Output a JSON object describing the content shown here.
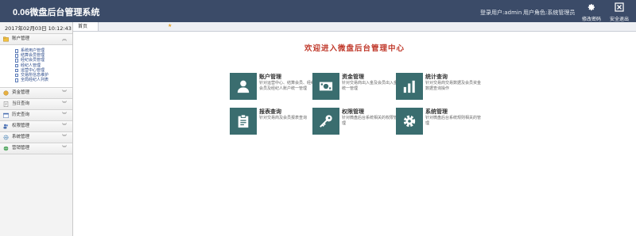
{
  "header": {
    "title": "0.06微盘后台管理系统",
    "login_user": "登录用户:admin",
    "user_role": "用户角色:系统管理员",
    "change_password": "修改密码",
    "logout": "安全退出"
  },
  "sidebar": {
    "datetime": "2017年02月03日 10:12:43",
    "account_menu": {
      "label": "账户管理",
      "items": [
        "系统用户管理",
        "结算会员管理",
        "经纪会员管理",
        "经纪人管理",
        "运营中心管理",
        "交易所信息维护",
        "全局经纪人列表"
      ]
    },
    "menus": [
      {
        "label": "资金管理"
      },
      {
        "label": "当日查询"
      },
      {
        "label": "历史查询"
      },
      {
        "label": "权限管理"
      },
      {
        "label": "系统管理"
      },
      {
        "label": "营销管理"
      }
    ]
  },
  "tabs": [
    {
      "label": "首页"
    }
  ],
  "main": {
    "welcome": "欢迎进入微盘后台管理中心",
    "cards": [
      {
        "title": "账户管理",
        "desc": "针对运营中心、结算会员、经纪会员及经纪人账户统一管理",
        "icon": "user-icon"
      },
      {
        "title": "资金管理",
        "desc": "针对交易商出入金及会员出入金统一管理",
        "icon": "money-icon"
      },
      {
        "title": "统计查询",
        "desc": "针对交易商交易数据及会员资金数据查询操作",
        "icon": "bar-chart-icon"
      },
      {
        "title": "报表查询",
        "desc": "针对交易商及会员报表查询",
        "icon": "clipboard-icon"
      },
      {
        "title": "权限管理",
        "desc": "针对微盘后台系统相关的权限管理",
        "icon": "key-icon"
      },
      {
        "title": "系统管理",
        "desc": "针对微盘后台系统规则相关的管理",
        "icon": "gear-icon"
      }
    ]
  },
  "colors": {
    "header_bg": "#3b4b68",
    "card_bg": "#3a6d6f",
    "welcome": "#c0392b"
  }
}
